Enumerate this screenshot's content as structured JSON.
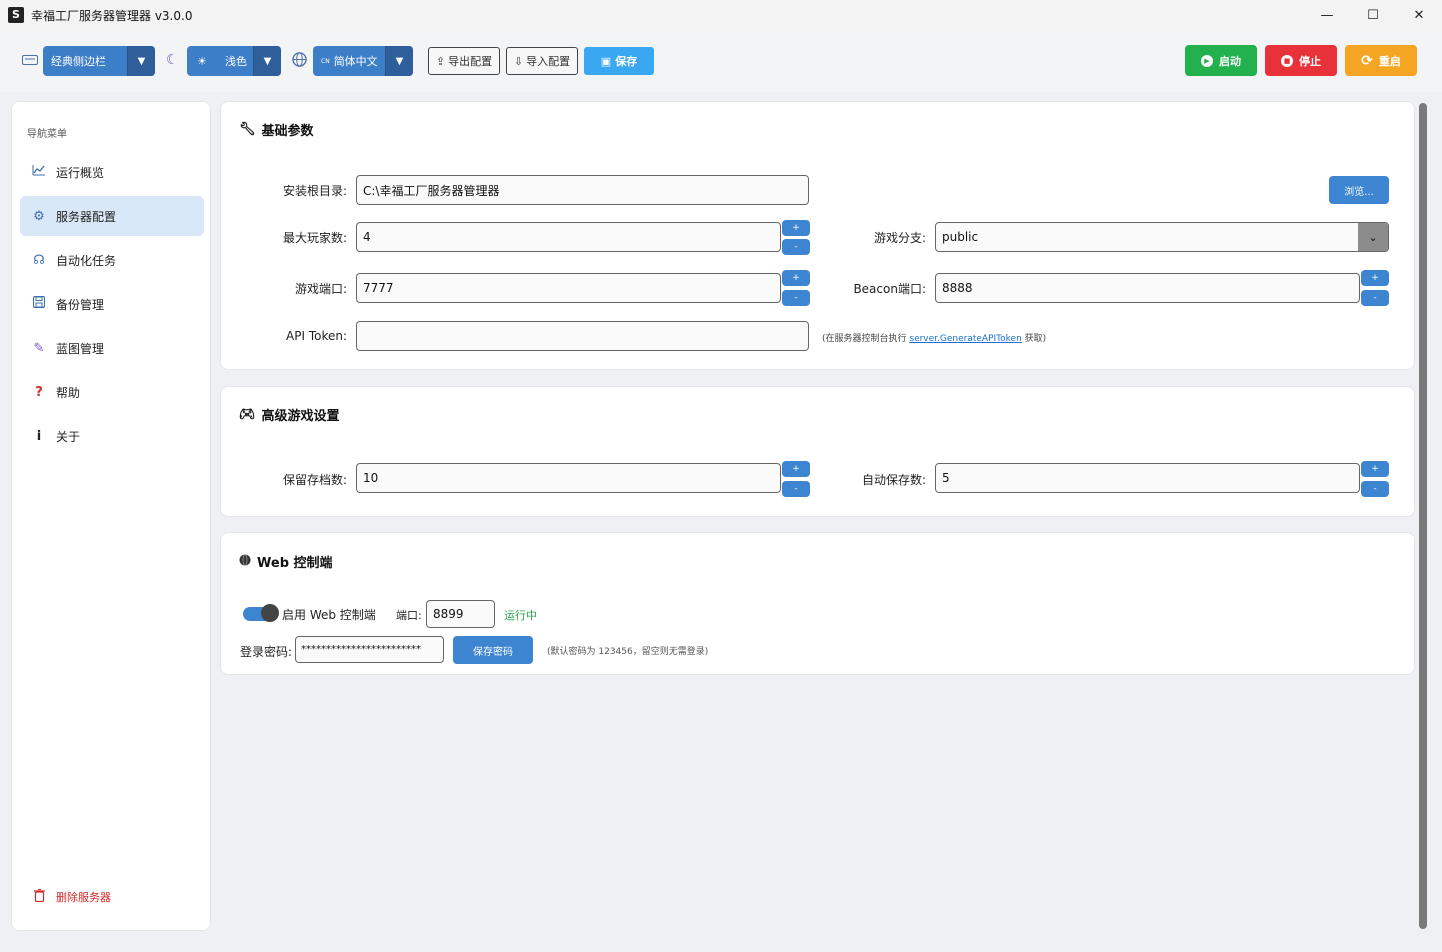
{
  "window": {
    "icon_letter": "S",
    "title": "幸福工厂服务器管理器 v3.0.0",
    "minimize": "—",
    "maximize": "☐",
    "close": "✕"
  },
  "toolbar": {
    "layout_combo": "经典侧边栏",
    "theme_combo": "浅色",
    "language_code": "CN",
    "language_combo": "简体中文",
    "export_label": "导出配置",
    "import_label": "导入配置",
    "save_label": "保存",
    "start_label": "启动",
    "stop_label": "停止",
    "restart_label": "重启",
    "start_color": "#22b14c",
    "stop_color": "#e8323a",
    "restart_color": "#f5a524"
  },
  "sidebar": {
    "title": "导航菜单",
    "items": [
      {
        "label": "运行概览",
        "icon": "chart-icon"
      },
      {
        "label": "服务器配置",
        "icon": "gear-icon"
      },
      {
        "label": "自动化任务",
        "icon": "robot-icon"
      },
      {
        "label": "备份管理",
        "icon": "save-icon"
      },
      {
        "label": "蓝图管理",
        "icon": "wrench-icon"
      },
      {
        "label": "帮助",
        "icon": "question-icon"
      },
      {
        "label": "关于",
        "icon": "info-icon"
      }
    ],
    "delete_label": "删除服务器"
  },
  "basic": {
    "title": "基础参数",
    "install_label": "安装根目录:",
    "install_value": "C:\\幸福工厂服务器管理器",
    "browse_label": "浏览...",
    "max_players_label": "最大玩家数:",
    "max_players_value": "4",
    "branch_label": "游戏分支:",
    "branch_value": "public",
    "port_label": "游戏端口:",
    "port_value": "7777",
    "beacon_label": "Beacon端口:",
    "beacon_value": "8888",
    "token_label": "API Token:",
    "token_value": "",
    "token_hint_prefix": "(在服务器控制台执行 ",
    "token_hint_link": "server.GenerateAPIToken",
    "token_hint_suffix": " 获取)"
  },
  "advanced": {
    "title": "高级游戏设置",
    "saves_label": "保留存档数:",
    "saves_value": "10",
    "autosave_label": "自动保存数:",
    "autosave_value": "5"
  },
  "web": {
    "title": "Web 控制端",
    "enable_label": "启用 Web 控制端",
    "port_label": "端口:",
    "port_value": "8899",
    "status": "运行中",
    "password_label": "登录密码:",
    "password_value": "************************",
    "save_password_label": "保存密码",
    "password_hint": "(默认密码为 123456，留空则无需登录)"
  },
  "spin": {
    "plus": "+",
    "minus": "-"
  }
}
